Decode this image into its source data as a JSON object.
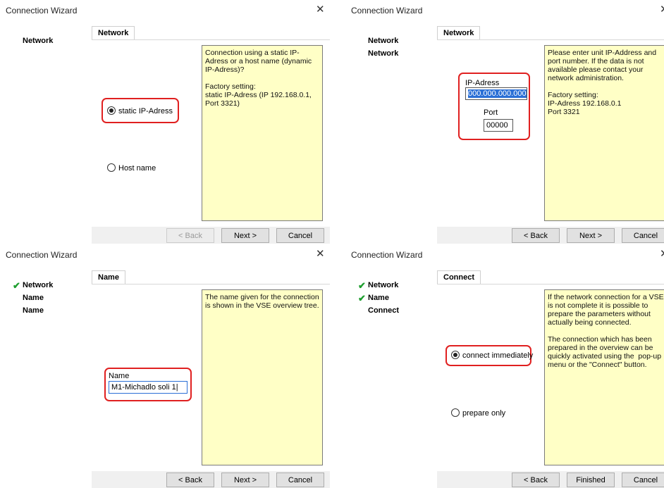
{
  "window_title": "Connection Wizard",
  "buttons": {
    "back": "< Back",
    "next": "Next >",
    "cancel": "Cancel",
    "finished": "Finished"
  },
  "p1": {
    "tab": "Network",
    "sidebar": [
      "Network"
    ],
    "info": "Connection using a static IP-Adress or a host name (dynamic IP-Adress)?\n\nFactory setting:\nstatic IP-Adress (IP 192.168.0.1, Port 3321)",
    "radio1": "static IP-Adress",
    "radio2": "Host name"
  },
  "p2": {
    "tab": "Network",
    "sidebar": [
      "Network",
      "Network"
    ],
    "info": "Please enter unit IP-Address and port number. If the data is not available please contact your network administration.\n\nFactory setting:\nIP-Adress 192.168.0.1\nPort 3321",
    "ip_label": "IP-Adress",
    "ip_value": "000.000.000.000",
    "port_label": "Port",
    "port_value": "00000"
  },
  "p3": {
    "tab": "Name",
    "sidebar": [
      "Network",
      "Name",
      "Name"
    ],
    "info": "The name given for the connection is shown in the VSE overview tree.",
    "name_label": "Name",
    "name_value": "M1-Michadlo soli 1"
  },
  "p4": {
    "tab": "Connect",
    "sidebar": [
      "Network",
      "Name",
      "Connect"
    ],
    "info": "If the network connection for a VSE is not complete it is possible to prepare the parameters without actually being connected.\n\nThe connection which has been prepared in the overview can be quickly activated using the  pop-up menu or the \"Connect\" button.",
    "radio1": "connect immediately",
    "radio2": "prepare only"
  }
}
